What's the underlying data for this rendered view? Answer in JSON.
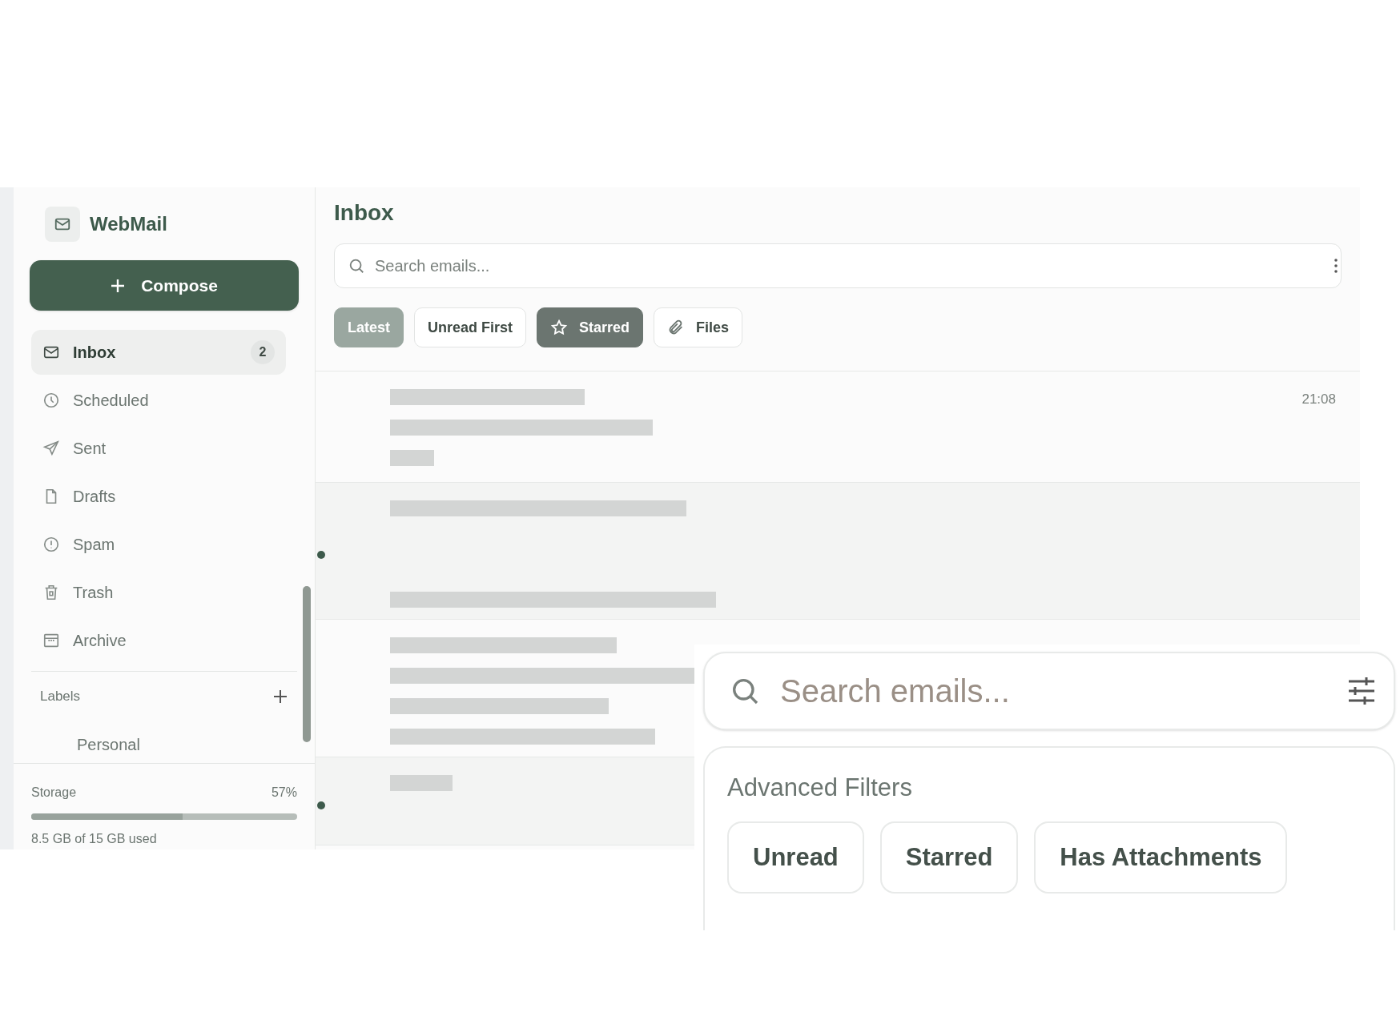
{
  "app": {
    "name": "WebMail"
  },
  "compose": {
    "label": "Compose"
  },
  "folders": [
    {
      "label": "Inbox",
      "count": "2",
      "selected": true
    },
    {
      "label": "Scheduled",
      "selected": false
    },
    {
      "label": "Sent",
      "selected": false
    },
    {
      "label": "Drafts",
      "selected": false
    },
    {
      "label": "Spam",
      "selected": false
    },
    {
      "label": "Trash",
      "selected": false
    },
    {
      "label": "Archive",
      "selected": false
    }
  ],
  "labels": {
    "title": "Labels",
    "items": [
      {
        "label": "Personal"
      }
    ]
  },
  "storage": {
    "label": "Storage",
    "percent": "57%",
    "level": 0.57,
    "usage": "8.5 GB of 15 GB used"
  },
  "main": {
    "title": "Inbox",
    "search": {
      "placeholder": "Search emails..."
    },
    "chips": [
      {
        "label": "Latest",
        "kind": "plain",
        "selected": true,
        "on": false
      },
      {
        "label": "Unread First",
        "kind": "plain",
        "selected": false,
        "on": false
      },
      {
        "label": "Starred",
        "kind": "star",
        "selected": false,
        "on": true
      },
      {
        "label": "Files",
        "kind": "clip",
        "selected": false,
        "on": false
      }
    ]
  },
  "emails": [
    {
      "time": "21:08",
      "unread": false
    },
    {
      "unread": true
    },
    {
      "unread": false
    },
    {
      "unread": true
    }
  ],
  "inset": {
    "search": {
      "placeholder": "Search emails..."
    },
    "filters": {
      "title": "Advanced Filters",
      "options": [
        {
          "label": "Unread"
        },
        {
          "label": "Starred"
        },
        {
          "label": "Has Attachments"
        }
      ]
    }
  }
}
